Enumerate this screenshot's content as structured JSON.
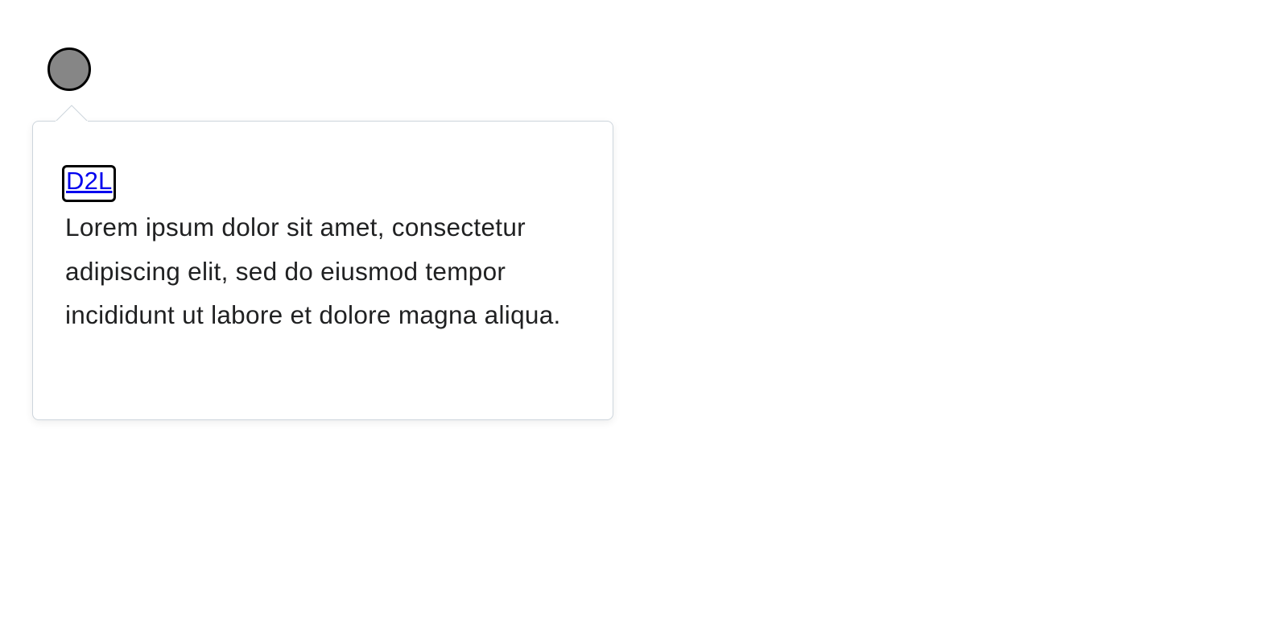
{
  "opener": {
    "fill_color": "#868686",
    "border_color": "#000000"
  },
  "dropdown": {
    "link_label": "D2L",
    "body_text": "Lorem ipsum dolor sit amet, consectetur adipiscing elit, sed do eiusmod tempor incididunt ut labore et dolore magna aliqua.",
    "border_color": "#cdd5dc",
    "text_color": "#202122",
    "link_color": "#0000ee"
  }
}
